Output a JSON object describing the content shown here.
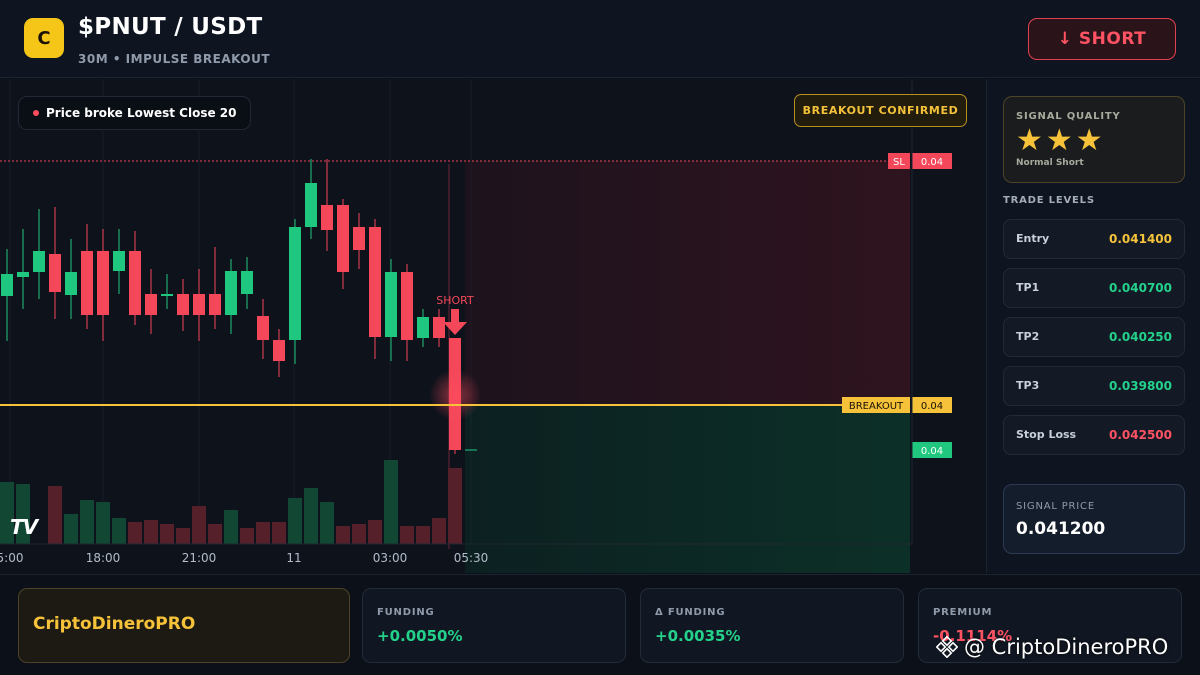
{
  "header": {
    "logo_letter": "C",
    "pair": "$PNUT / USDT",
    "subtitle": "30M • IMPULSE BREAKOUT",
    "short_button": "↓ SHORT"
  },
  "chart": {
    "info_pill": "Price broke Lowest Close 20",
    "badge": "BREAKOUT CONFIRMED",
    "sl_tag": "SL",
    "sl_value": "0.04",
    "breakout_tag": "BREAKOUT",
    "breakout_value": "0.04",
    "current_value": "0.04",
    "signal_marker": "SHORT",
    "time_labels": [
      "5:00",
      "18:00",
      "21:00",
      "11",
      "03:00",
      "05:30"
    ],
    "tv_logo": "TV",
    "colors": {
      "up": "#20c77e",
      "down": "#f4475a",
      "breakout": "#f5c23a"
    }
  },
  "sidebar": {
    "quality_title": "SIGNAL QUALITY",
    "stars": "★★★",
    "star_count": 3,
    "quality_sub": "Normal Short",
    "levels_title": "TRADE LEVELS",
    "levels": [
      {
        "label": "Entry",
        "value": "0.041400",
        "color": "#f5c23a"
      },
      {
        "label": "TP1",
        "value": "0.040700",
        "color": "#23d18b"
      },
      {
        "label": "TP2",
        "value": "0.040250",
        "color": "#23d18b"
      },
      {
        "label": "TP3",
        "value": "0.039800",
        "color": "#23d18b"
      },
      {
        "label": "Stop Loss",
        "value": "0.042500",
        "color": "#ff5263"
      }
    ],
    "signal_price_title": "SIGNAL PRICE",
    "signal_price": "0.041200"
  },
  "bottom": {
    "brand": "CriptoDineroPRO",
    "funding_title": "FUNDING",
    "funding_value": "+0.0050%",
    "delta_title": "Δ FUNDING",
    "delta_value": "+0.0035%",
    "premium_title": "PREMIUM",
    "premium_value": "-0.1114%",
    "watermark": "@ CriptoDineroPRO"
  }
}
